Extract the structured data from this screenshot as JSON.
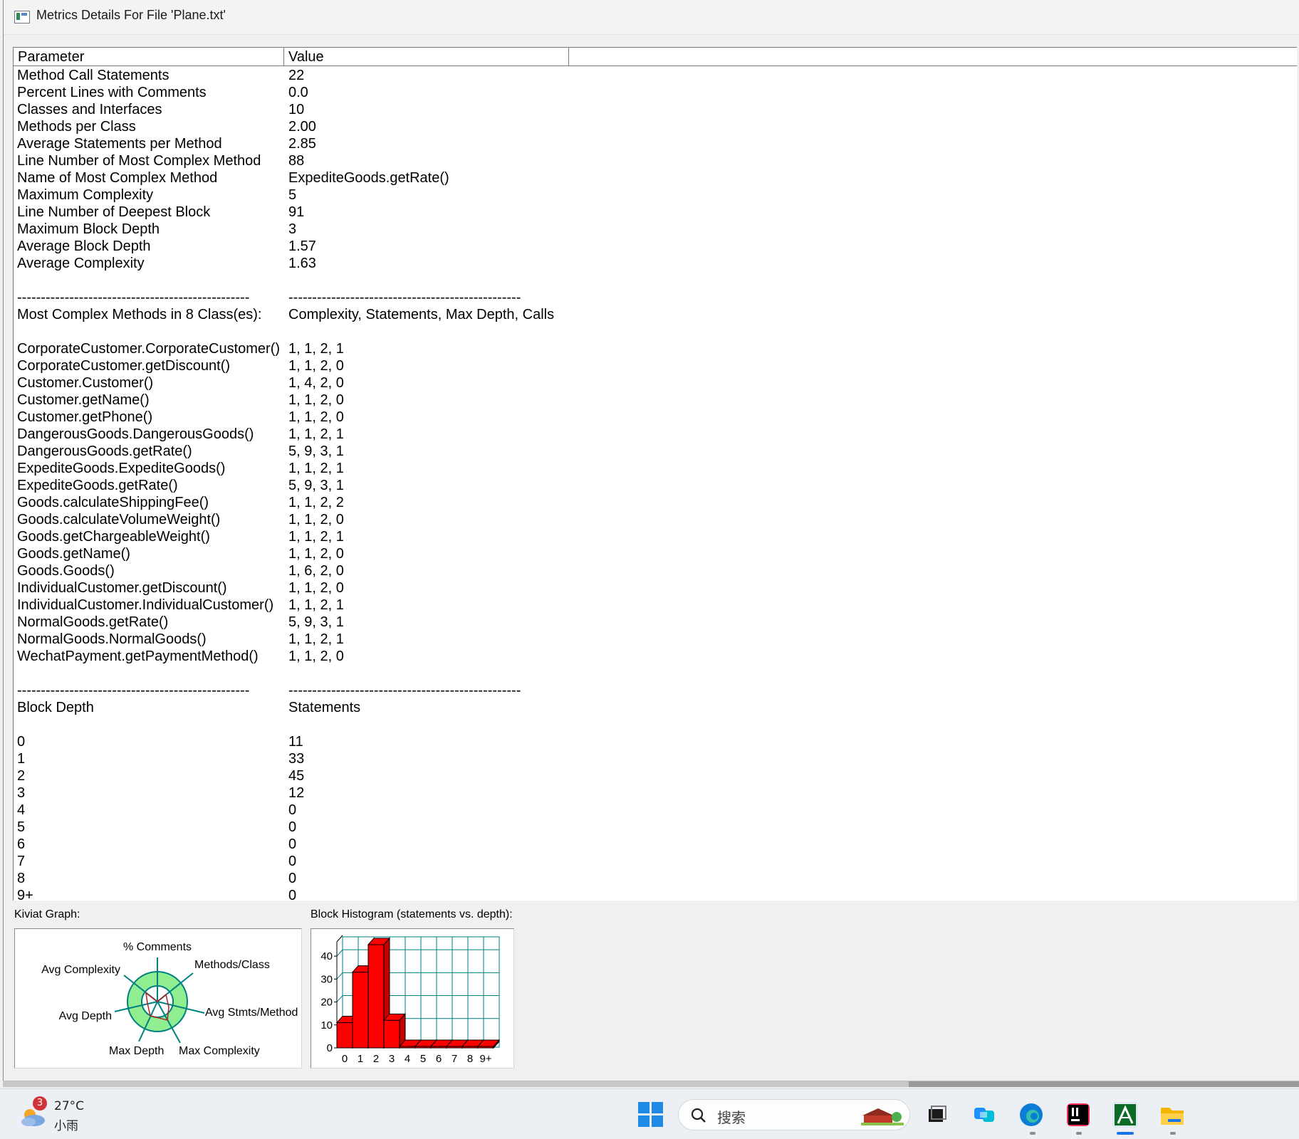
{
  "window": {
    "title": "Metrics Details For File 'Plane.txt'"
  },
  "table": {
    "headers": {
      "parameter": "Parameter",
      "value": "Value"
    },
    "rows": [
      [
        "Method Call Statements",
        "22"
      ],
      [
        "Percent Lines with Comments",
        "0.0"
      ],
      [
        "Classes and Interfaces",
        "10"
      ],
      [
        "Methods per Class",
        "2.00"
      ],
      [
        "Average Statements per Method",
        "2.85"
      ],
      [
        "Line Number of Most Complex Method",
        "88"
      ],
      [
        "Name of Most Complex Method",
        "ExpediteGoods.getRate()"
      ],
      [
        "Maximum Complexity",
        "5"
      ],
      [
        "Line Number of Deepest Block",
        "91"
      ],
      [
        "Maximum Block Depth",
        "3"
      ],
      [
        "Average Block Depth",
        "1.57"
      ],
      [
        "Average Complexity",
        "1.63"
      ],
      [
        "",
        ""
      ],
      [
        "-------------------------------------------------",
        "-------------------------------------------------"
      ],
      [
        "Most Complex Methods in 8 Class(es):",
        "Complexity, Statements, Max Depth, Calls"
      ],
      [
        "",
        ""
      ],
      [
        "CorporateCustomer.CorporateCustomer()",
        "1, 1, 2, 1"
      ],
      [
        "CorporateCustomer.getDiscount()",
        "1, 1, 2, 0"
      ],
      [
        "Customer.Customer()",
        "1, 4, 2, 0"
      ],
      [
        "Customer.getName()",
        "1, 1, 2, 0"
      ],
      [
        "Customer.getPhone()",
        "1, 1, 2, 0"
      ],
      [
        "DangerousGoods.DangerousGoods()",
        "1, 1, 2, 1"
      ],
      [
        "DangerousGoods.getRate()",
        "5, 9, 3, 1"
      ],
      [
        "ExpediteGoods.ExpediteGoods()",
        "1, 1, 2, 1"
      ],
      [
        "ExpediteGoods.getRate()",
        "5, 9, 3, 1"
      ],
      [
        "Goods.calculateShippingFee()",
        "1, 1, 2, 2"
      ],
      [
        "Goods.calculateVolumeWeight()",
        "1, 1, 2, 0"
      ],
      [
        "Goods.getChargeableWeight()",
        "1, 1, 2, 1"
      ],
      [
        "Goods.getName()",
        "1, 1, 2, 0"
      ],
      [
        "Goods.Goods()",
        "1, 6, 2, 0"
      ],
      [
        "IndividualCustomer.getDiscount()",
        "1, 1, 2, 0"
      ],
      [
        "IndividualCustomer.IndividualCustomer()",
        "1, 1, 2, 1"
      ],
      [
        "NormalGoods.getRate()",
        "5, 9, 3, 1"
      ],
      [
        "NormalGoods.NormalGoods()",
        "1, 1, 2, 1"
      ],
      [
        "WechatPayment.getPaymentMethod()",
        "1, 1, 2, 0"
      ],
      [
        "",
        ""
      ],
      [
        "-------------------------------------------------",
        "-------------------------------------------------"
      ],
      [
        "Block Depth",
        "Statements"
      ],
      [
        "",
        ""
      ],
      [
        "0",
        "11"
      ],
      [
        "1",
        "33"
      ],
      [
        "2",
        "45"
      ],
      [
        "3",
        "12"
      ],
      [
        "4",
        "0"
      ],
      [
        "5",
        "0"
      ],
      [
        "6",
        "0"
      ],
      [
        "7",
        "0"
      ],
      [
        "8",
        "0"
      ],
      [
        "9+",
        "0"
      ]
    ]
  },
  "kiviat": {
    "label": "Kiviat Graph:",
    "axes": [
      "% Comments",
      "Methods/Class",
      "Avg Stmts/Method",
      "Max Complexity",
      "Max Depth",
      "Avg Depth",
      "Avg Complexity"
    ],
    "colors": {
      "ring": "#90ee90",
      "spokes": "#008080",
      "plot": "#b22222"
    }
  },
  "histogram": {
    "label": "Block Histogram (statements vs. depth):",
    "bar_color": "#ff0000",
    "grid_color": "#008080"
  },
  "chart_data": {
    "type": "bar",
    "categories": [
      "0",
      "1",
      "2",
      "3",
      "4",
      "5",
      "6",
      "7",
      "8",
      "9+"
    ],
    "values": [
      11,
      33,
      45,
      12,
      0,
      0,
      0,
      0,
      0,
      0
    ],
    "yticks": [
      "0",
      "10",
      "20",
      "30",
      "40"
    ],
    "ylim": [
      0,
      45
    ],
    "grid": true
  },
  "taskbar": {
    "weather": {
      "badge": "3",
      "temp": "27°C",
      "desc": "小雨"
    },
    "search_placeholder": "搜索",
    "apps": [
      "start-icon",
      "task-view-icon",
      "copilot-icon",
      "edge-icon",
      "intellij-icon",
      "sourcemonitor-icon",
      "file-explorer-icon"
    ]
  }
}
